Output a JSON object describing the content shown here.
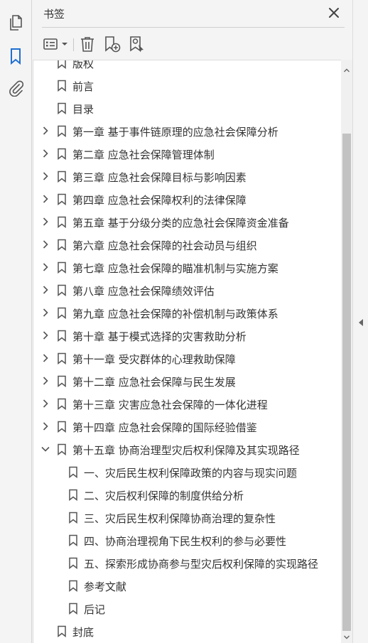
{
  "panel": {
    "title": "书签"
  },
  "colors": {
    "accent": "#1f6fd1",
    "icon": "#555555",
    "text": "#333333"
  },
  "left_rail": {
    "items": [
      {
        "icon": "pages-icon",
        "active": false
      },
      {
        "icon": "bookmark-icon",
        "active": true
      },
      {
        "icon": "attachment-icon",
        "active": false
      }
    ]
  },
  "toolbar": {
    "items": [
      "options-menu-icon",
      "delete-icon",
      "new-bookmark-icon",
      "new-bookmark-from-structure-icon"
    ]
  },
  "bookmarks": [
    {
      "label": "版权",
      "level": 0,
      "expander": "none"
    },
    {
      "label": "前言",
      "level": 0,
      "expander": "none"
    },
    {
      "label": "目录",
      "level": 0,
      "expander": "none"
    },
    {
      "label": "第一章  基于事件链原理的应急社会保障分析",
      "level": 0,
      "expander": "collapsed"
    },
    {
      "label": "第二章  应急社会保障管理体制",
      "level": 0,
      "expander": "collapsed"
    },
    {
      "label": "第三章  应急社会保障目标与影响因素",
      "level": 0,
      "expander": "collapsed"
    },
    {
      "label": "第四章  应急社会保障权利的法律保障",
      "level": 0,
      "expander": "collapsed"
    },
    {
      "label": "第五章  基于分级分类的应急社会保障资金准备",
      "level": 0,
      "expander": "collapsed"
    },
    {
      "label": "第六章  应急社会保障的社会动员与组织",
      "level": 0,
      "expander": "collapsed"
    },
    {
      "label": "第七章  应急社会保障的瞄准机制与实施方案",
      "level": 0,
      "expander": "collapsed"
    },
    {
      "label": "第八章  应急社会保障绩效评估",
      "level": 0,
      "expander": "collapsed"
    },
    {
      "label": "第九章  应急社会保障的补偿机制与政策体系",
      "level": 0,
      "expander": "collapsed"
    },
    {
      "label": "第十章  基于模式选择的灾害救助分析",
      "level": 0,
      "expander": "collapsed"
    },
    {
      "label": "第十一章  受灾群体的心理救助保障",
      "level": 0,
      "expander": "collapsed"
    },
    {
      "label": "第十二章  应急社会保障与民生发展",
      "level": 0,
      "expander": "collapsed"
    },
    {
      "label": "第十三章  灾害应急社会保障的一体化进程",
      "level": 0,
      "expander": "collapsed"
    },
    {
      "label": "第十四章  应急社会保障的国际经验借鉴",
      "level": 0,
      "expander": "collapsed"
    },
    {
      "label": "第十五章  协商治理型灾后权利保障及其实现路径",
      "level": 0,
      "expander": "expanded"
    },
    {
      "label": "一、灾后民生权利保障政策的内容与现实问题",
      "level": 1,
      "expander": "none"
    },
    {
      "label": "二、灾后权利保障的制度供给分析",
      "level": 1,
      "expander": "none"
    },
    {
      "label": "三、灾后民生权利保障协商治理的复杂性",
      "level": 1,
      "expander": "none"
    },
    {
      "label": "四、协商治理视角下民生权利的参与必要性",
      "level": 1,
      "expander": "none"
    },
    {
      "label": "五、探索形成协商参与型灾后权利保障的实现路径",
      "level": 1,
      "expander": "none"
    },
    {
      "label": "参考文献",
      "level": 1,
      "expander": "none"
    },
    {
      "label": "后记",
      "level": 1,
      "expander": "none"
    },
    {
      "label": "封底",
      "level": 0,
      "expander": "none"
    }
  ]
}
